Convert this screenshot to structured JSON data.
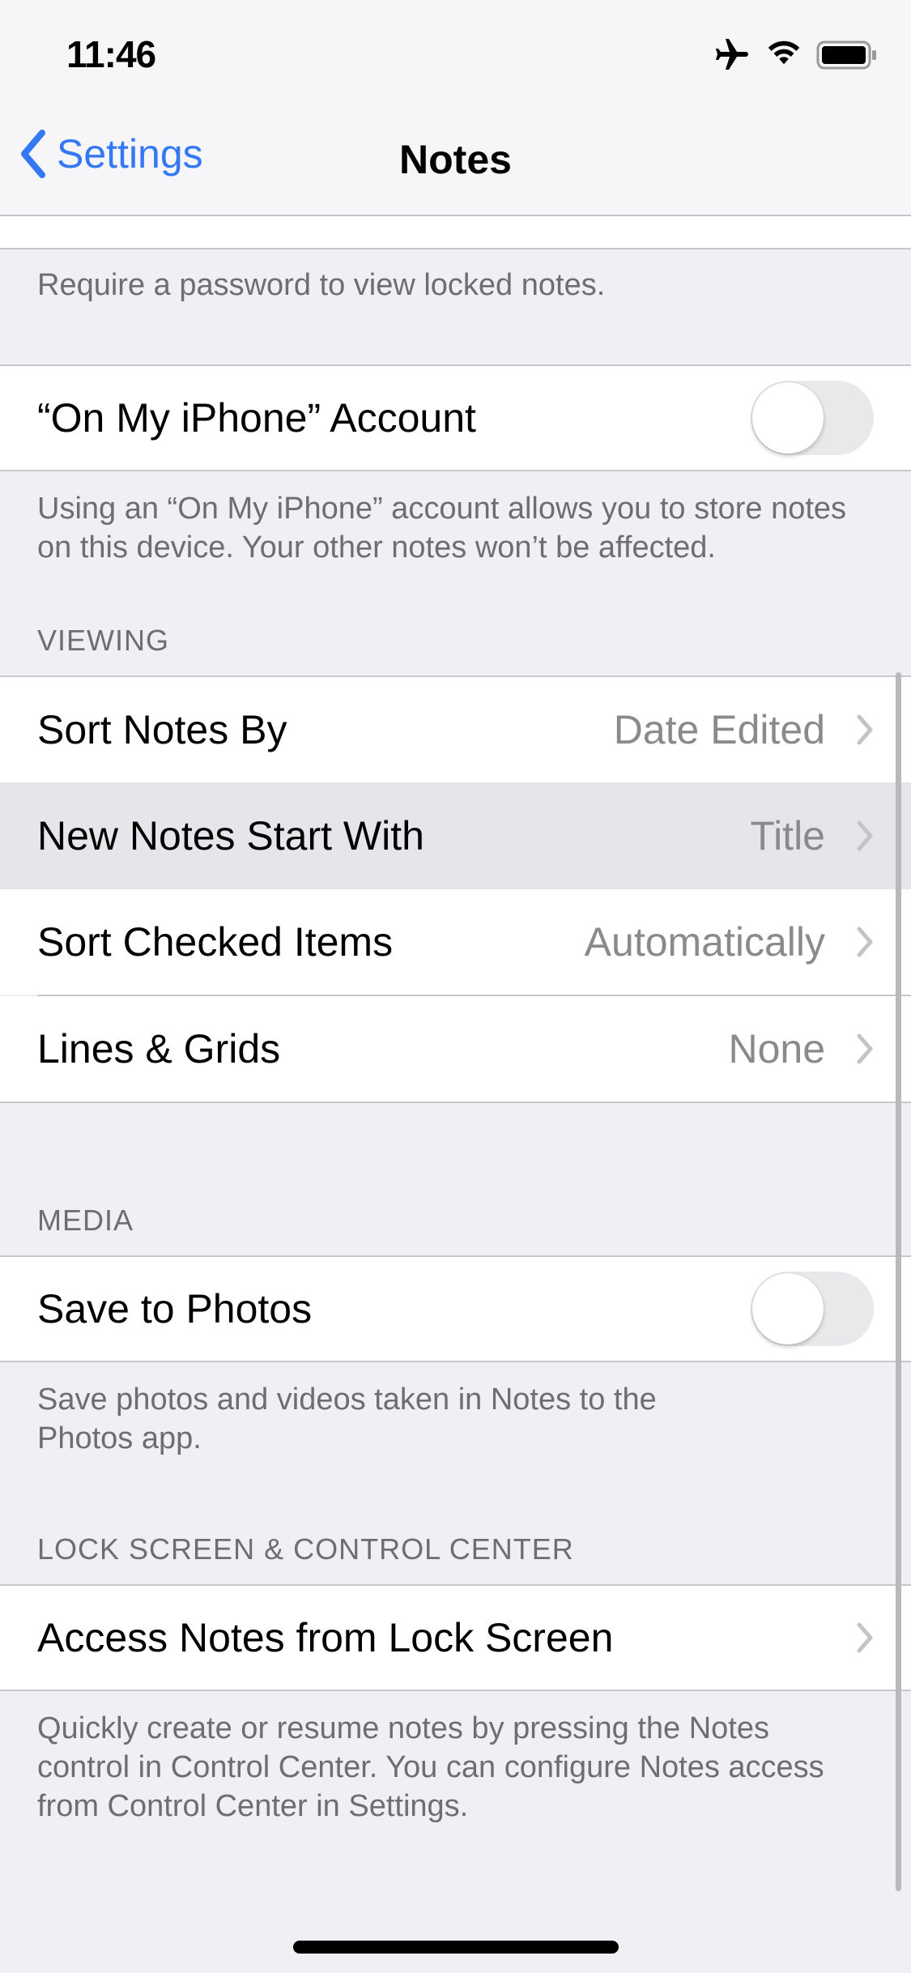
{
  "status_bar": {
    "time": "11:46",
    "icons": [
      "airplane-icon",
      "wifi-icon",
      "battery-icon"
    ]
  },
  "nav": {
    "back_label": "Settings",
    "title": "Notes"
  },
  "password_footer": "Require a password to view locked notes.",
  "on_my_iphone": {
    "label": "“On My iPhone” Account",
    "toggle_on": false,
    "footer": "Using an “On My iPhone” account allows you to store notes on this device. Your other notes won’t be affected."
  },
  "viewing": {
    "header": "VIEWING",
    "rows": [
      {
        "label": "Sort Notes By",
        "value": "Date Edited"
      },
      {
        "label": "New Notes Start With",
        "value": "Title",
        "highlighted": true
      },
      {
        "label": "Sort Checked Items",
        "value": "Automatically"
      },
      {
        "label": "Lines & Grids",
        "value": "None"
      }
    ]
  },
  "media": {
    "header": "MEDIA",
    "save_to_photos": {
      "label": "Save to Photos",
      "toggle_on": false
    },
    "footer": "Save photos and videos taken in Notes to the Photos app."
  },
  "lock_screen": {
    "header": "LOCK SCREEN & CONTROL CENTER",
    "row_label": "Access Notes from Lock Screen",
    "footer": "Quickly create or resume notes by pressing the Notes control in Control Center. You can configure Notes access from Control Center in Settings."
  },
  "colors": {
    "accent": "#3478f6",
    "background": "#efeff4",
    "secondary_text": "#8a8a8e",
    "footer_text": "#6d6d72"
  }
}
